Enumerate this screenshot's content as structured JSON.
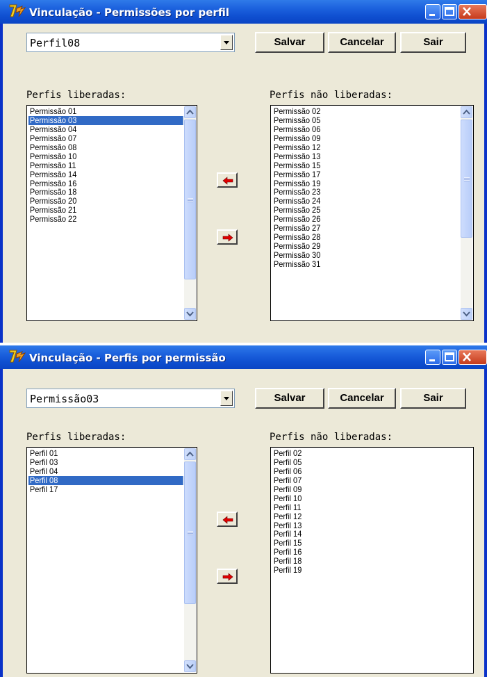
{
  "window1": {
    "title": "Vinculação - Permissões por perfil",
    "combo_value": "Perfil08",
    "buttons": {
      "save": "Salvar",
      "cancel": "Cancelar",
      "exit": "Sair"
    },
    "left_label": "Perfis liberadas:",
    "right_label": "Perfis não liberadas:",
    "left_items": [
      "Permissão 01",
      "Permissão 03",
      "Permissão 04",
      "Permissão 07",
      "Permissão 08",
      "Permissão 10",
      "Permissão 11",
      "Permissão 14",
      "Permissão 16",
      "Permissão 18",
      "Permissão 20",
      "Permissão 21",
      "Permissão 22"
    ],
    "left_selected": "Permissão 03",
    "right_items": [
      "Permissão 02",
      "Permissão 05",
      "Permissão 06",
      "Permissão 09",
      "Permissão 12",
      "Permissão 13",
      "Permissão 15",
      "Permissão 17",
      "Permissão 19",
      "Permissão 23",
      "Permissão 24",
      "Permissão 25",
      "Permissão 26",
      "Permissão 27",
      "Permissão 28",
      "Permissão 29",
      "Permissão 30",
      "Permissão 31"
    ]
  },
  "window2": {
    "title": "Vinculação - Perfis por permissão",
    "combo_value": "Permissão03",
    "buttons": {
      "save": "Salvar",
      "cancel": "Cancelar",
      "exit": "Sair"
    },
    "left_label": "Perfis liberadas:",
    "right_label": "Perfis não liberadas:",
    "left_items": [
      "Perfil 01",
      "Perfil 03",
      "Perfil 04",
      "Perfil 08",
      "Perfil 17"
    ],
    "left_selected": "Perfil 08",
    "right_items": [
      "Perfil 02",
      "Perfil 05",
      "Perfil 06",
      "Perfil 07",
      "Perfil 09",
      "Perfil 10",
      "Perfil 11",
      "Perfil 12",
      "Perfil 13",
      "Perfil 14",
      "Perfil 15",
      "Perfil 16",
      "Perfil 18",
      "Perfil 19"
    ]
  },
  "icons": {
    "app": "app-logo-icon",
    "minimize": "minimize-icon",
    "maximize": "maximize-icon",
    "close": "close-icon",
    "dropdown": "chevron-down-icon",
    "move_left": "arrow-left-icon",
    "move_right": "arrow-right-icon"
  },
  "colors": {
    "titlebar": "#0a4ed0",
    "selection": "#316ac5",
    "arrow": "#e00000",
    "client": "#ece9d8"
  }
}
